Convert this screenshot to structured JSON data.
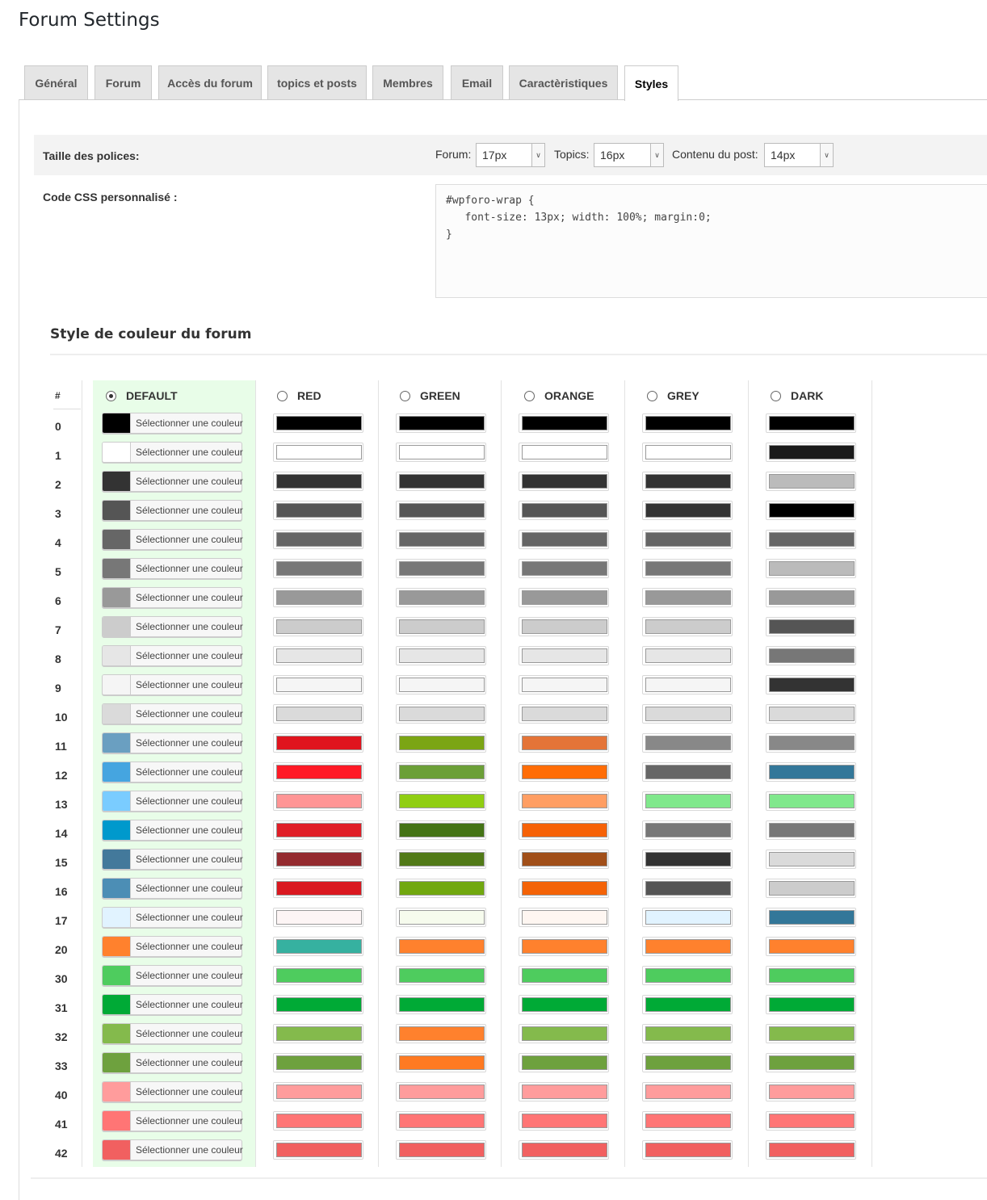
{
  "page": {
    "title": "Forum Settings"
  },
  "tabs": [
    {
      "label": "Général",
      "active": false
    },
    {
      "label": "Forum",
      "active": false
    },
    {
      "label": "Accès du forum",
      "active": false
    },
    {
      "label": "topics et posts",
      "active": false
    },
    {
      "label": "Membres",
      "active": false
    },
    {
      "label": "Email",
      "active": false
    },
    {
      "label": "Caractèristiques",
      "active": false
    },
    {
      "label": "Styles",
      "active": true
    }
  ],
  "fonts": {
    "label": "Taille des polices:",
    "forum_label": "Forum:",
    "forum_value": "17px",
    "topics_label": "Topics:",
    "topics_value": "16px",
    "post_label": "Contenu du post:",
    "post_value": "14px"
  },
  "custom_css": {
    "label": "Code CSS personnalisé :",
    "value": "#wpforo-wrap {\n   font-size: 13px; width: 100%; margin:0;\n}"
  },
  "colors_section": {
    "title": "Style de couleur du forum",
    "hash_label": "#",
    "picker_label": "Sélectionner une couleur",
    "selected_scheme": "DEFAULT",
    "row_numbers": [
      "0",
      "1",
      "2",
      "3",
      "4",
      "5",
      "6",
      "7",
      "8",
      "9",
      "10",
      "11",
      "12",
      "13",
      "14",
      "15",
      "16",
      "17",
      "20",
      "30",
      "31",
      "32",
      "33",
      "40",
      "41",
      "42"
    ],
    "schemes": [
      {
        "name": "DEFAULT",
        "colors": [
          "#000000",
          "#FFFFFF",
          "#333333",
          "#555555",
          "#666666",
          "#777777",
          "#999999",
          "#CCCCCC",
          "#E6E6E6",
          "#F5F5F5",
          "#DADADA",
          "#6A9FC1",
          "#45A5E0",
          "#7ACCFF",
          "#0099CC",
          "#43799B",
          "#4C8EB5",
          "#E1F3FF",
          "#FF812D",
          "#4ECC5E",
          "#00AA36",
          "#84BA4C",
          "#6EA13E",
          "#FF9C9C",
          "#FF7575",
          "#F16060"
        ]
      },
      {
        "name": "RED",
        "colors": [
          "#000000",
          "#FFFFFF",
          "#333333",
          "#555555",
          "#666666",
          "#777777",
          "#999999",
          "#CCCCCC",
          "#E6E6E6",
          "#F5F5F5",
          "#DADADA",
          "#E0141E",
          "#FF1A26",
          "#FF9595",
          "#E01E27",
          "#942A2F",
          "#DA1820",
          "#FDF5F5",
          "#36B1A0",
          "#4ECC5E",
          "#00AA36",
          "#84BA4C",
          "#6EA13E",
          "#FF9C9C",
          "#FF7575",
          "#F16060"
        ]
      },
      {
        "name": "GREEN",
        "colors": [
          "#000000",
          "#FFFFFF",
          "#333333",
          "#555555",
          "#666666",
          "#777777",
          "#999999",
          "#CCCCCC",
          "#E6E6E6",
          "#F5F5F5",
          "#DADADA",
          "#7BA514",
          "#6B9F37",
          "#90CE12",
          "#447315",
          "#517A17",
          "#71A80F",
          "#F6FBED",
          "#FF812D",
          "#4ECC5E",
          "#00AA36",
          "#FF812D",
          "#FF7A22",
          "#FF9C9C",
          "#FF7575",
          "#F16060"
        ]
      },
      {
        "name": "ORANGE",
        "colors": [
          "#000000",
          "#FFFFFF",
          "#333333",
          "#555555",
          "#666666",
          "#777777",
          "#999999",
          "#CCCCCC",
          "#E6E6E6",
          "#F5F5F5",
          "#DADADA",
          "#E47438",
          "#FF6D07",
          "#FF9E63",
          "#F66106",
          "#A14F19",
          "#F46307",
          "#FEF6F1",
          "#FF812D",
          "#4ECC5E",
          "#00AA36",
          "#84BA4C",
          "#6EA13E",
          "#FF9C9C",
          "#FF7575",
          "#F16060"
        ]
      },
      {
        "name": "GREY",
        "colors": [
          "#000000",
          "#FFFFFF",
          "#333333",
          "#333333",
          "#666666",
          "#777777",
          "#999999",
          "#CCCCCC",
          "#E6E6E6",
          "#F5F5F5",
          "#DADADA",
          "#888888",
          "#666666",
          "#80E88C",
          "#777777",
          "#333333",
          "#555555",
          "#E1F3FF",
          "#FF812D",
          "#4ECC5E",
          "#00AA36",
          "#84BA4C",
          "#6EA13E",
          "#FF9C9C",
          "#FF7575",
          "#F16060"
        ]
      },
      {
        "name": "DARK",
        "colors": [
          "#000000",
          "#1A1A1A",
          "#BBBBBB",
          "#000000",
          "#666666",
          "#BBBBBB",
          "#999999",
          "#555555",
          "#777777",
          "#333333",
          "#DADADA",
          "#888888",
          "#337799",
          "#80E88C",
          "#777777",
          "#DADADA",
          "#CCCCCC",
          "#337799",
          "#FF812D",
          "#4ECC5E",
          "#00AA36",
          "#84BA4C",
          "#6EA13E",
          "#FF9C9C",
          "#FF7575",
          "#F16060"
        ]
      }
    ]
  }
}
